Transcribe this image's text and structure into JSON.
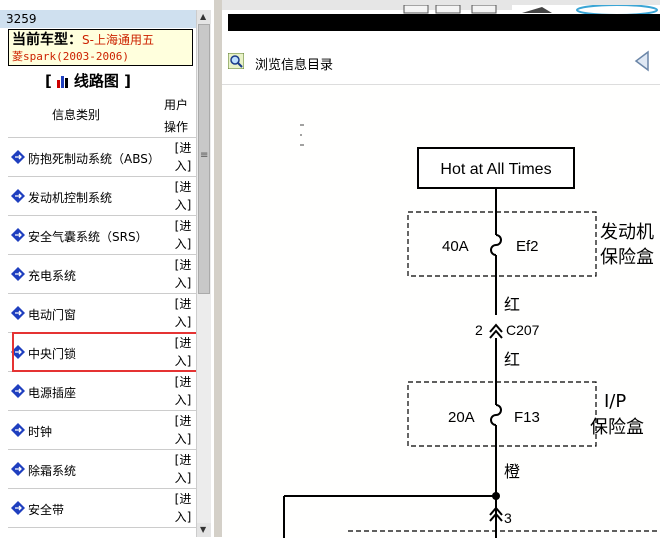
{
  "left_panel": {
    "record_id": "3259",
    "current_model_label": "当前车型：",
    "current_model_value": "S-上海通用五菱spark(2003-2006)",
    "current_model_line1": "S-上海通用五",
    "current_model_line2": "菱spark(2003-2006)",
    "wiring_title_left": "[",
    "wiring_title": "线路图",
    "wiring_title_right": "]",
    "col_category": "信息类别",
    "col_user_ops_line1": "用户",
    "col_user_ops_line2": "操作",
    "enter_top": "[进",
    "enter_bottom": "入]",
    "items": [
      {
        "label": "防抱死制动系统（ABS）"
      },
      {
        "label": "发动机控制系统"
      },
      {
        "label": "安全气囊系统（SRS）"
      },
      {
        "label": "充电系统"
      },
      {
        "label": "电动门窗"
      },
      {
        "label": "中央门锁"
      },
      {
        "label": "电源插座"
      },
      {
        "label": "时钟"
      },
      {
        "label": "除霜系统"
      },
      {
        "label": "安全带"
      }
    ],
    "selected_item": "中央门锁",
    "icon": "diamond-arrow-icon"
  },
  "right_panel": {
    "nav_label": "浏览信息目录",
    "nav_icon": "magnifier-icon",
    "back_icon": "back-arrow-icon"
  },
  "diagram": {
    "hot_label": "Hot at All Times",
    "fuse1_amp": "40A",
    "fuse1_id": "Ef2",
    "fuse1_box_line1": "发动机",
    "fuse1_box_line2": "保险盒",
    "wire1_color": "红",
    "connector_pin": "2",
    "connector_id": "C207",
    "wire2_color": "红",
    "fuse2_amp": "20A",
    "fuse2_id": "F13",
    "fuse2_box_line1": "I/P",
    "fuse2_box_line2": "保险盒",
    "wire3_color": "橙",
    "pin3": "3"
  },
  "colors": {
    "selection_box": "#e53333",
    "model_value": "#cc2200",
    "model_bg": "#ffffdd",
    "id_bar": "#cfe0ef",
    "icon_blue": "#1f3fbf"
  }
}
